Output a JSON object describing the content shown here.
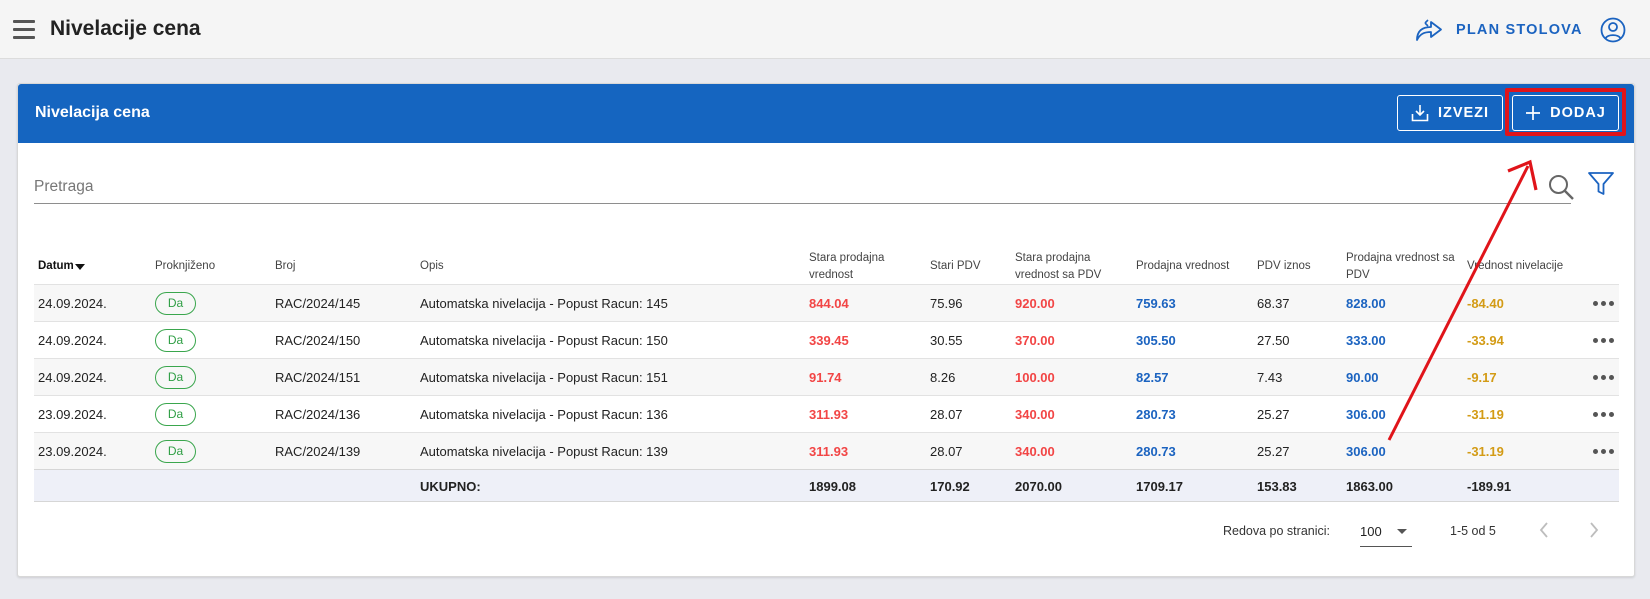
{
  "app": {
    "title": "Nivelacije cena",
    "plan_label": "PLAN STOLOVA"
  },
  "card": {
    "title": "Nivelacija cena",
    "export_label": "IZVEZI",
    "add_label": "DODAJ"
  },
  "search": {
    "placeholder": "Pretraga"
  },
  "table": {
    "headers": {
      "datum": "Datum",
      "proknjizeno": "Proknjiženo",
      "broj": "Broj",
      "opis": "Opis",
      "stara_prodajna_1": "Stara prodajna",
      "stara_prodajna_2": "vrednost",
      "stari_pdv": "Stari PDV",
      "stara_sa_pdv_1": "Stara prodajna",
      "stara_sa_pdv_2": "vrednost sa PDV",
      "prodajna": "Prodajna vrednost",
      "pdv_iznos": "PDV iznos",
      "prodajna_sa_pdv_1": "Prodajna vrednost sa",
      "prodajna_sa_pdv_2": "PDV",
      "nivelacija": "Vrednost nivelacije"
    },
    "rows": [
      {
        "datum": "24.09.2024.",
        "proknjizeno": "Da",
        "broj": "RAC/2024/145",
        "opis": "Automatska nivelacija - Popust Racun: 145",
        "stara": "844.04",
        "stari_pdv": "75.96",
        "stara_sa_pdv": "920.00",
        "prodajna": "759.63",
        "pdv": "68.37",
        "prodajna_sa_pdv": "828.00",
        "nivelacija": "-84.40"
      },
      {
        "datum": "24.09.2024.",
        "proknjizeno": "Da",
        "broj": "RAC/2024/150",
        "opis": "Automatska nivelacija - Popust Racun: 150",
        "stara": "339.45",
        "stari_pdv": "30.55",
        "stara_sa_pdv": "370.00",
        "prodajna": "305.50",
        "pdv": "27.50",
        "prodajna_sa_pdv": "333.00",
        "nivelacija": "-33.94"
      },
      {
        "datum": "24.09.2024.",
        "proknjizeno": "Da",
        "broj": "RAC/2024/151",
        "opis": "Automatska nivelacija - Popust Racun: 151",
        "stara": "91.74",
        "stari_pdv": "8.26",
        "stara_sa_pdv": "100.00",
        "prodajna": "82.57",
        "pdv": "7.43",
        "prodajna_sa_pdv": "90.00",
        "nivelacija": "-9.17"
      },
      {
        "datum": "23.09.2024.",
        "proknjizeno": "Da",
        "broj": "RAC/2024/136",
        "opis": "Automatska nivelacija - Popust Racun: 136",
        "stara": "311.93",
        "stari_pdv": "28.07",
        "stara_sa_pdv": "340.00",
        "prodajna": "280.73",
        "pdv": "25.27",
        "prodajna_sa_pdv": "306.00",
        "nivelacija": "-31.19"
      },
      {
        "datum": "23.09.2024.",
        "proknjizeno": "Da",
        "broj": "RAC/2024/139",
        "opis": "Automatska nivelacija - Popust Racun: 139",
        "stara": "311.93",
        "stari_pdv": "28.07",
        "stara_sa_pdv": "340.00",
        "prodajna": "280.73",
        "pdv": "25.27",
        "prodajna_sa_pdv": "306.00",
        "nivelacija": "-31.19"
      }
    ],
    "totals": {
      "label": "UKUPNO:",
      "stara": "1899.08",
      "stari_pdv": "170.92",
      "stara_sa_pdv": "2070.00",
      "prodajna": "1709.17",
      "pdv": "153.83",
      "prodajna_sa_pdv": "1863.00",
      "nivelacija": "-189.91"
    }
  },
  "pager": {
    "rows_label": "Redova po stranici:",
    "rows_value": "100",
    "range": "1-5 od 5"
  },
  "colors": {
    "header_blue": "#1565c0",
    "old_value_red": "#f24545",
    "new_value_blue": "#1b63c0",
    "diff_orange": "#d39b15",
    "posted_green": "#2e9e44",
    "annotation_red": "#e0141a"
  }
}
